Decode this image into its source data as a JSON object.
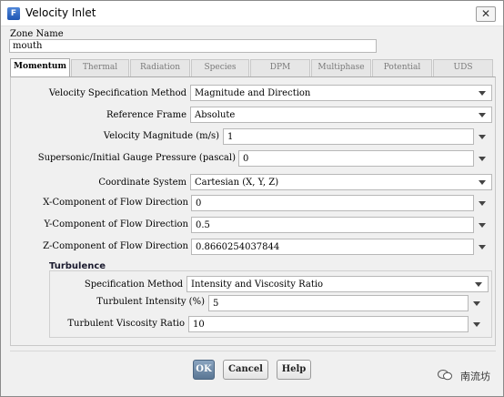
{
  "window": {
    "title": "Velocity Inlet",
    "app_icon": "F"
  },
  "zone": {
    "label": "Zone Name",
    "value": "mouth"
  },
  "tabs": [
    "Momentum",
    "Thermal",
    "Radiation",
    "Species",
    "DPM",
    "Multiphase",
    "Potential",
    "UDS"
  ],
  "active_tab": "Momentum",
  "momentum": {
    "velocity_spec_method": {
      "label": "Velocity Specification Method",
      "value": "Magnitude and Direction"
    },
    "reference_frame": {
      "label": "Reference Frame",
      "value": "Absolute"
    },
    "velocity_magnitude": {
      "label": "Velocity Magnitude (m/s)",
      "value": "1"
    },
    "gauge_pressure": {
      "label": "Supersonic/Initial Gauge Pressure (pascal)",
      "value": "0"
    },
    "coordinate_system": {
      "label": "Coordinate System",
      "value": "Cartesian (X, Y, Z)"
    },
    "x_component": {
      "label": "X-Component of Flow Direction",
      "value": "0"
    },
    "y_component": {
      "label": "Y-Component of Flow Direction",
      "value": "0.5"
    },
    "z_component": {
      "label": "Z-Component of Flow Direction",
      "value": "0.8660254037844"
    }
  },
  "turbulence": {
    "title": "Turbulence",
    "spec_method": {
      "label": "Specification Method",
      "value": "Intensity and Viscosity Ratio"
    },
    "intensity": {
      "label": "Turbulent Intensity (%)",
      "value": "5"
    },
    "viscosity_ratio": {
      "label": "Turbulent Viscosity Ratio",
      "value": "10"
    }
  },
  "buttons": {
    "ok": "OK",
    "cancel": "Cancel",
    "help": "Help"
  },
  "watermark": "南流坊",
  "colors": {
    "title_icon": "#2f6cc8",
    "ok_button": "#6f8aa8",
    "group_title": "#1a1a2e"
  }
}
